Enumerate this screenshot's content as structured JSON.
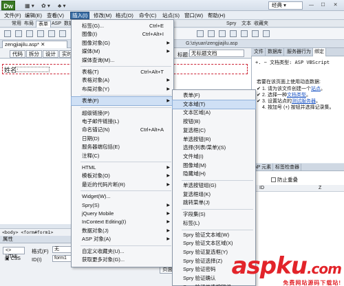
{
  "app": {
    "logo": "Dw",
    "workspace": "经典 ▾",
    "toolbar_glyphs": [
      "▦ ▾",
      "✿ ▾",
      "♣ ▾"
    ],
    "window_controls": [
      "—",
      "☐",
      "✕"
    ]
  },
  "menubar": [
    "文件(F)",
    "编辑(E)",
    "查看(V)",
    "插入(I)",
    "修改(M)",
    "格式(O)",
    "命令(C)",
    "站点(S)",
    "窗口(W)",
    "帮助(H)"
  ],
  "insert_tabs": [
    "常用",
    "布局",
    "表单",
    "ASP",
    "数据",
    "Spry",
    "文本",
    "收藏夹"
  ],
  "document": {
    "tabs": [
      "zengjiajilu.asp*",
      "✕"
    ],
    "path": "G:\\ziyuan\\zengjiajilu.asp",
    "views": [
      "代码",
      "拆分",
      "设计",
      "实时"
    ],
    "title_label": "标题:",
    "title_value": "无标题文档",
    "name_label": "姓名:"
  },
  "status": {
    "tag_path": "<body> <form#form1>",
    "props_title": "属性",
    "html_label": "HTML",
    "css_label": "CSS",
    "format_label": "格式(F)",
    "format_value": "无",
    "id_label": "ID(I)",
    "id_value": "form1",
    "page_props": "页面"
  },
  "right_panel": {
    "tabs": [
      "文件",
      "数据库",
      "服务器行为",
      "绑定"
    ],
    "plus": "+.",
    "minus": "−",
    "doc_type": "文档类型: ASP VBScript",
    "intro": "若要在该页面上使用动态数据:",
    "steps": [
      {
        "num": "1.",
        "pre": "请为该文件创建一个",
        "link": "站点",
        "post": "。"
      },
      {
        "num": "2.",
        "pre": "选择一种",
        "link": "文档类型",
        "post": "。"
      },
      {
        "num": "3.",
        "pre": "设置站点的",
        "link": "测试服务器",
        "post": "。"
      },
      {
        "num": "4.",
        "pre": "按加号 (+) 按钮并选择记录集。",
        "link": "",
        "post": ""
      }
    ],
    "panel2_tabs": [
      "AP 元素",
      "标签检查器"
    ],
    "prevent_overlap": "防止重叠",
    "col_id": "ID",
    "col_z": "Z"
  },
  "insert_menu": [
    {
      "label": "标签(G)...",
      "shortcut": "Ctrl+E"
    },
    {
      "label": "图像(I)",
      "shortcut": "Ctrl+Alt+I"
    },
    {
      "label": "图像对象(G)",
      "arrow": "▶"
    },
    {
      "label": "媒体(M)",
      "arrow": "▶"
    },
    {
      "label": "媒体查询(M)..."
    },
    {
      "sep": true
    },
    {
      "label": "表格(T)",
      "shortcut": "Ctrl+Alt+T"
    },
    {
      "label": "表格对象(A)",
      "arrow": "▶"
    },
    {
      "label": "布局对象(Y)",
      "arrow": "▶"
    },
    {
      "sep": true
    },
    {
      "label": "表单(F)",
      "arrow": "▶",
      "highlight": true
    },
    {
      "sep": true
    },
    {
      "label": "超级链接(P)"
    },
    {
      "label": "电子邮件链接(L)"
    },
    {
      "label": "命名锚记(N)",
      "shortcut": "Ctrl+Alt+A"
    },
    {
      "label": "日期(D)"
    },
    {
      "label": "服务器端包括(E)"
    },
    {
      "label": "注释(C)"
    },
    {
      "sep": true
    },
    {
      "label": "HTML",
      "arrow": "▶"
    },
    {
      "label": "模板对象(O)",
      "arrow": "▶"
    },
    {
      "label": "最近的代码片断(R)",
      "arrow": "▶"
    },
    {
      "sep": true
    },
    {
      "label": "Widget(W)..."
    },
    {
      "label": "Spry(S)",
      "arrow": "▶"
    },
    {
      "label": "jQuery Mobile",
      "arrow": "▶"
    },
    {
      "label": "InContext Editing(I)",
      "arrow": "▶"
    },
    {
      "label": "数据对象(J)",
      "arrow": "▶"
    },
    {
      "label": "ASP 对象(A)",
      "arrow": "▶"
    },
    {
      "sep": true
    },
    {
      "label": "自定义收藏夹(U)..."
    },
    {
      "label": "获取更多对象(G)..."
    }
  ],
  "form_submenu": [
    {
      "label": "表单(F)"
    },
    {
      "label": "文本域(T)",
      "highlight": true
    },
    {
      "label": "文本区域(A)"
    },
    {
      "label": "按钮(B)"
    },
    {
      "label": "复选框(C)"
    },
    {
      "label": "单选按钮(R)"
    },
    {
      "label": "选择(列表/菜单)(S)"
    },
    {
      "label": "文件域(I)"
    },
    {
      "label": "图像域(M)"
    },
    {
      "label": "隐藏域(H)"
    },
    {
      "sep": true
    },
    {
      "label": "单选按钮组(G)"
    },
    {
      "label": "复选框组(K)"
    },
    {
      "label": "跳转菜单(J)"
    },
    {
      "sep": true
    },
    {
      "label": "字段集(S)"
    },
    {
      "label": "标签(L)"
    },
    {
      "sep": true
    },
    {
      "label": "Spry 验证文本域(W)"
    },
    {
      "label": "Spry 验证文本区域(X)"
    },
    {
      "label": "Spry 验证复选框(Y)"
    },
    {
      "label": "Spry 验证选择(Z)"
    },
    {
      "label": "Spry 验证密码"
    },
    {
      "label": "Spry 验证确认"
    },
    {
      "label": "Spry 验证单选按钮组"
    }
  ],
  "watermark": {
    "asp": "asp",
    "ku": "ku",
    "tld": ".com",
    "sub": "免费网站源码下载站!"
  }
}
